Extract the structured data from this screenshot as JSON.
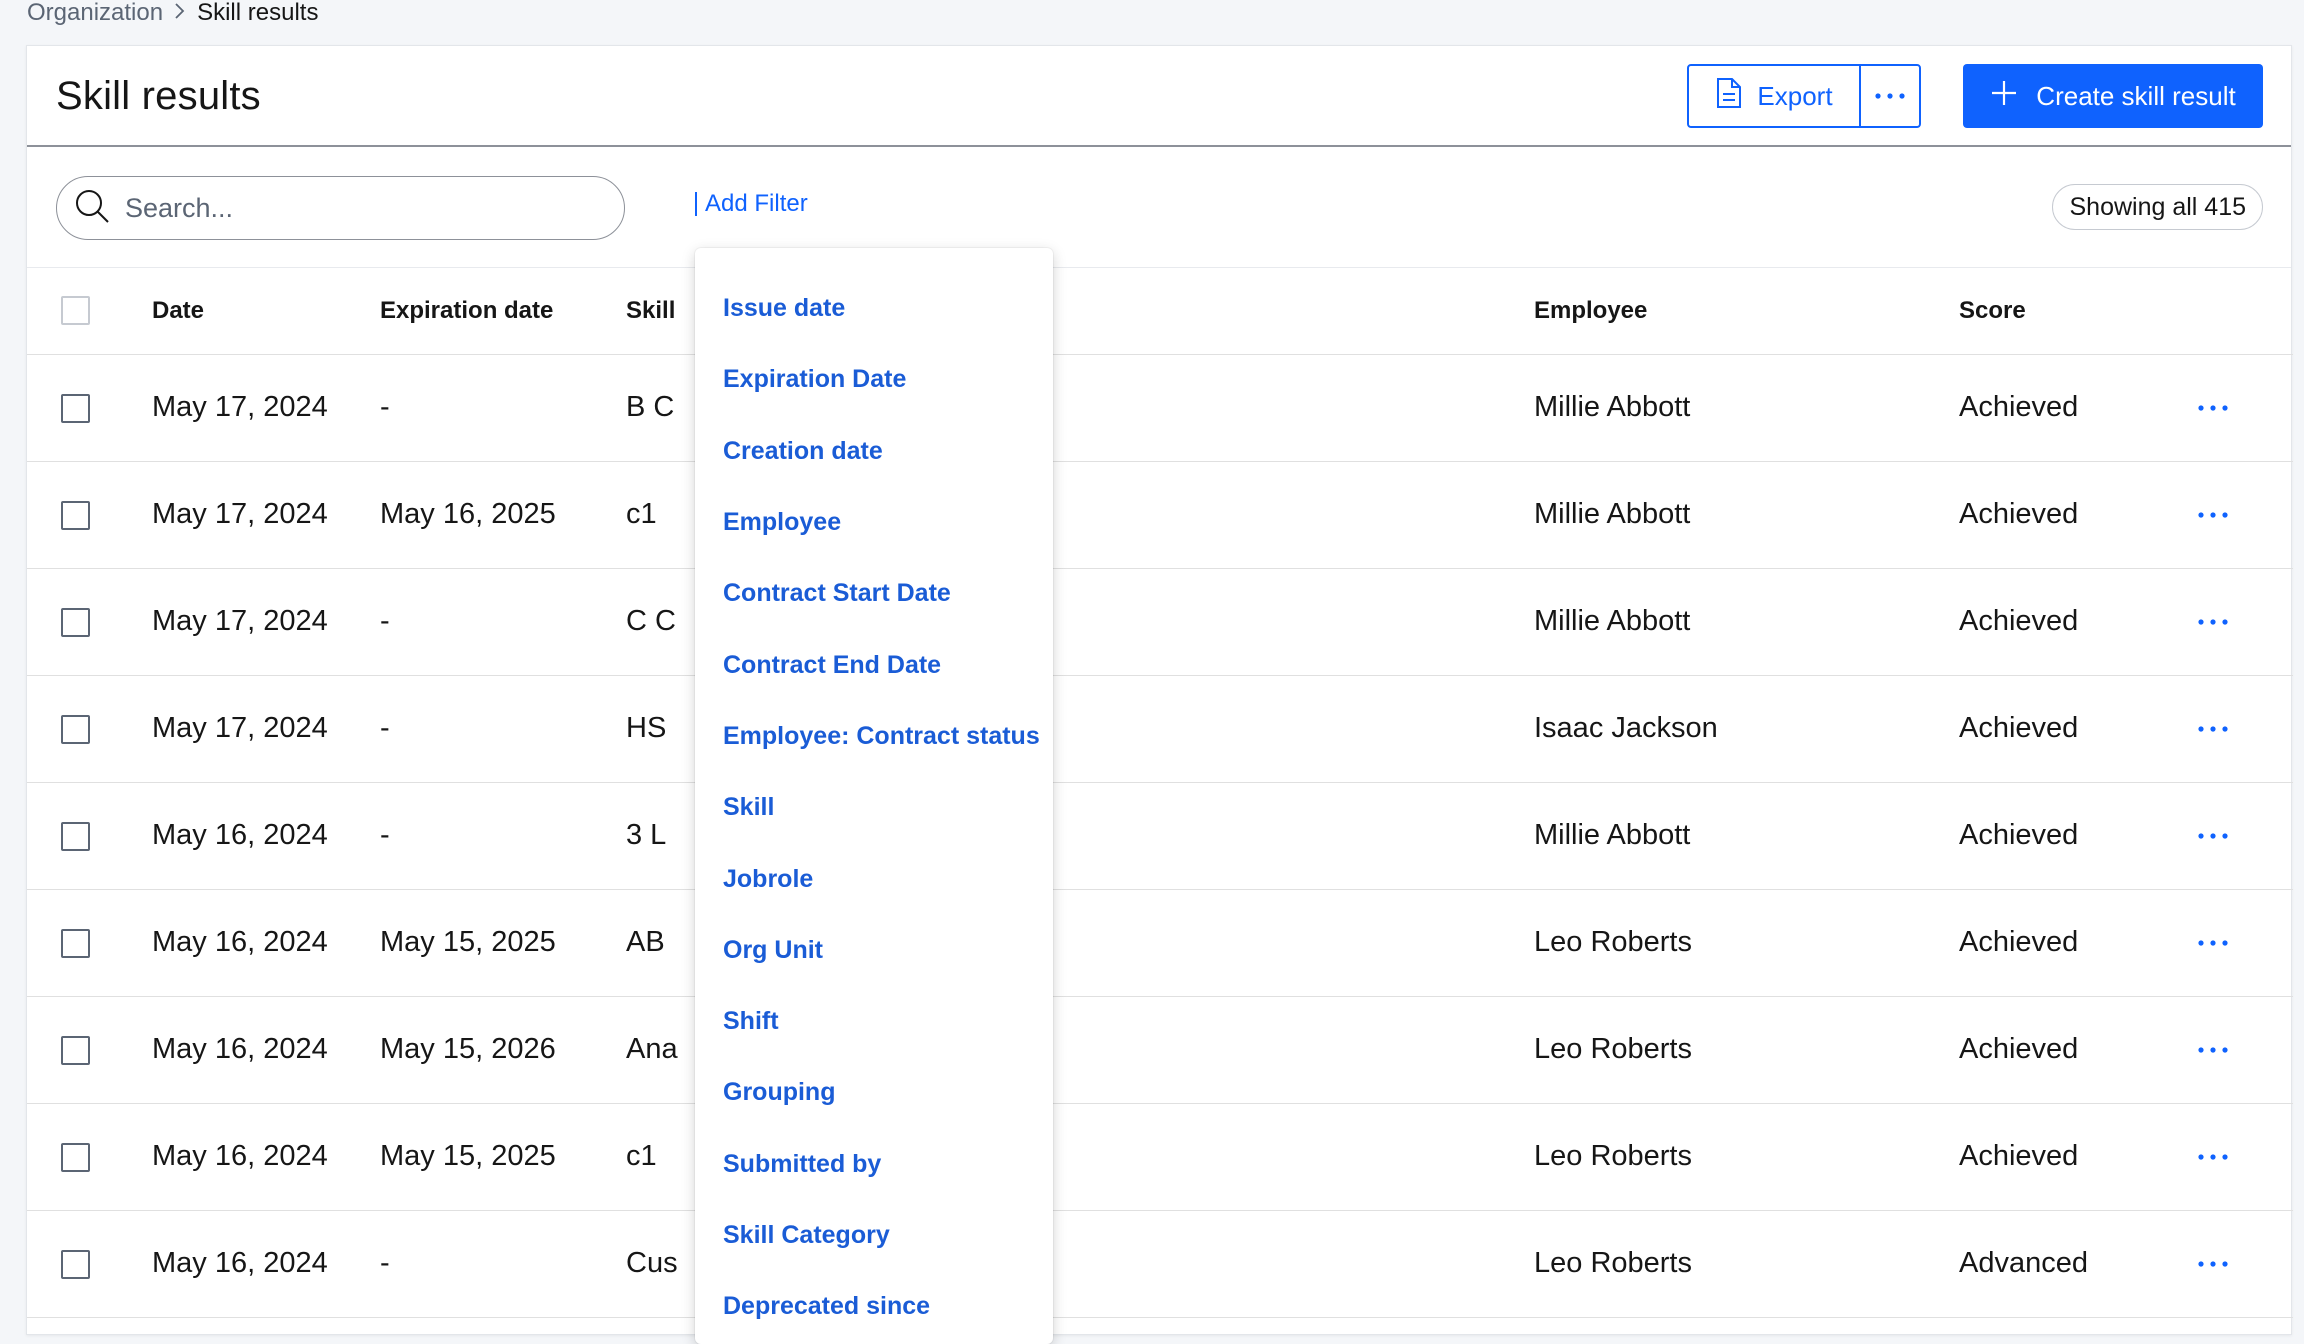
{
  "breadcrumb": {
    "parent": "Organization",
    "current": "Skill results"
  },
  "header": {
    "title": "Skill results",
    "export_label": "Export",
    "create_label": "Create skill result"
  },
  "toolbar": {
    "search_placeholder": "Search...",
    "add_filter_label": "Add Filter",
    "showing_label": "Showing all 415"
  },
  "table": {
    "columns": {
      "date": "Date",
      "expiration": "Expiration date",
      "skill": "Skill",
      "employee": "Employee",
      "score": "Score"
    },
    "rows": [
      {
        "date": "May 17, 2024",
        "expiration": "-",
        "skill": "B C",
        "employee": "Millie Abbott",
        "score": "Achieved"
      },
      {
        "date": "May 17, 2024",
        "expiration": "May 16, 2025",
        "skill": "c1",
        "employee": "Millie Abbott",
        "score": "Achieved"
      },
      {
        "date": "May 17, 2024",
        "expiration": "-",
        "skill": "C C",
        "employee": "Millie Abbott",
        "score": "Achieved"
      },
      {
        "date": "May 17, 2024",
        "expiration": "-",
        "skill": "HS",
        "employee": "Isaac Jackson",
        "score": "Achieved"
      },
      {
        "date": "May 16, 2024",
        "expiration": "-",
        "skill": "3 L",
        "employee": "Millie Abbott",
        "score": "Achieved"
      },
      {
        "date": "May 16, 2024",
        "expiration": "May 15, 2025",
        "skill": "AB",
        "employee": "Leo Roberts",
        "score": "Achieved"
      },
      {
        "date": "May 16, 2024",
        "expiration": "May 15, 2026",
        "skill": "Ana",
        "employee": "Leo Roberts",
        "score": "Achieved"
      },
      {
        "date": "May 16, 2024",
        "expiration": "May 15, 2025",
        "skill": "c1",
        "employee": "Leo Roberts",
        "score": "Achieved"
      },
      {
        "date": "May 16, 2024",
        "expiration": "-",
        "skill": "Cus",
        "employee": "Leo Roberts",
        "score": "Advanced"
      }
    ]
  },
  "filter_menu": {
    "options": [
      "Issue date",
      "Expiration Date",
      "Creation date",
      "Employee",
      "Contract Start Date",
      "Contract End Date",
      "Employee: Contract status",
      "Skill",
      "Jobrole",
      "Org Unit",
      "Shift",
      "Grouping",
      "Submitted by",
      "Skill Category",
      "Deprecated since"
    ]
  },
  "colors": {
    "accent": "#0f62fe",
    "text": "#161616",
    "muted": "#5b6574"
  },
  "icons": {
    "export": "document-icon",
    "more": "overflow-menu-icon",
    "create": "plus-icon",
    "search": "search-icon"
  }
}
